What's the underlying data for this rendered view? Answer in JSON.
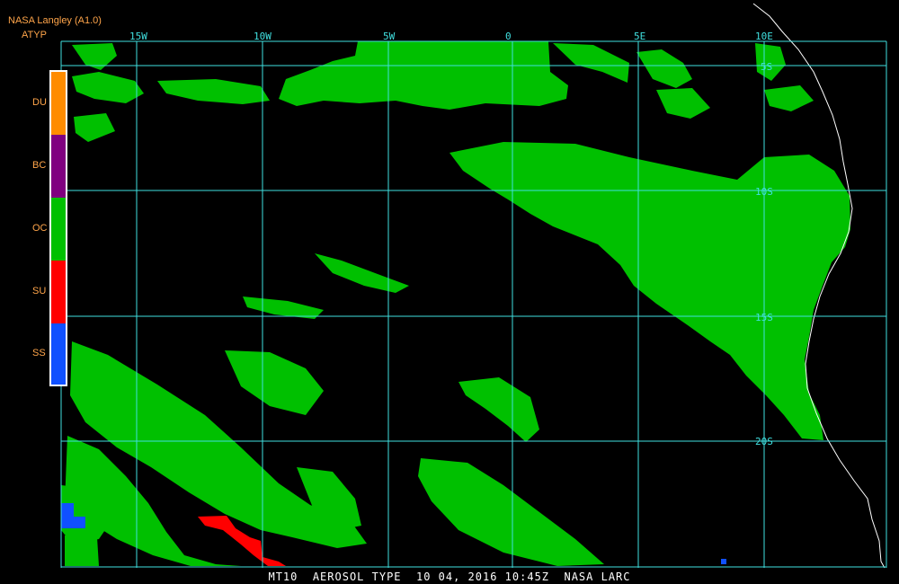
{
  "header": {
    "title": "NASA Langley (A1.0)",
    "product": "ATYP"
  },
  "legend": {
    "items": [
      {
        "label": "DU",
        "color": "#ff8c00"
      },
      {
        "label": "BC",
        "color": "#800080"
      },
      {
        "label": "OC",
        "color": "#00c000"
      },
      {
        "label": "SU",
        "color": "#ff0000"
      },
      {
        "label": "SS",
        "color": "#1050ff"
      }
    ]
  },
  "map": {
    "lon_labels": [
      "15W",
      "10W",
      "5W",
      "0",
      "5E",
      "10E"
    ],
    "lat_labels": [
      "5S",
      "10S",
      "15S",
      "20S"
    ],
    "grid_color": "#40e0e0",
    "land_color": "#000000",
    "coast_color": "#ffffff"
  },
  "footer": {
    "caption": "MT10  AEROSOL TYPE  10 04, 2016 10:45Z  NASA LARC"
  }
}
